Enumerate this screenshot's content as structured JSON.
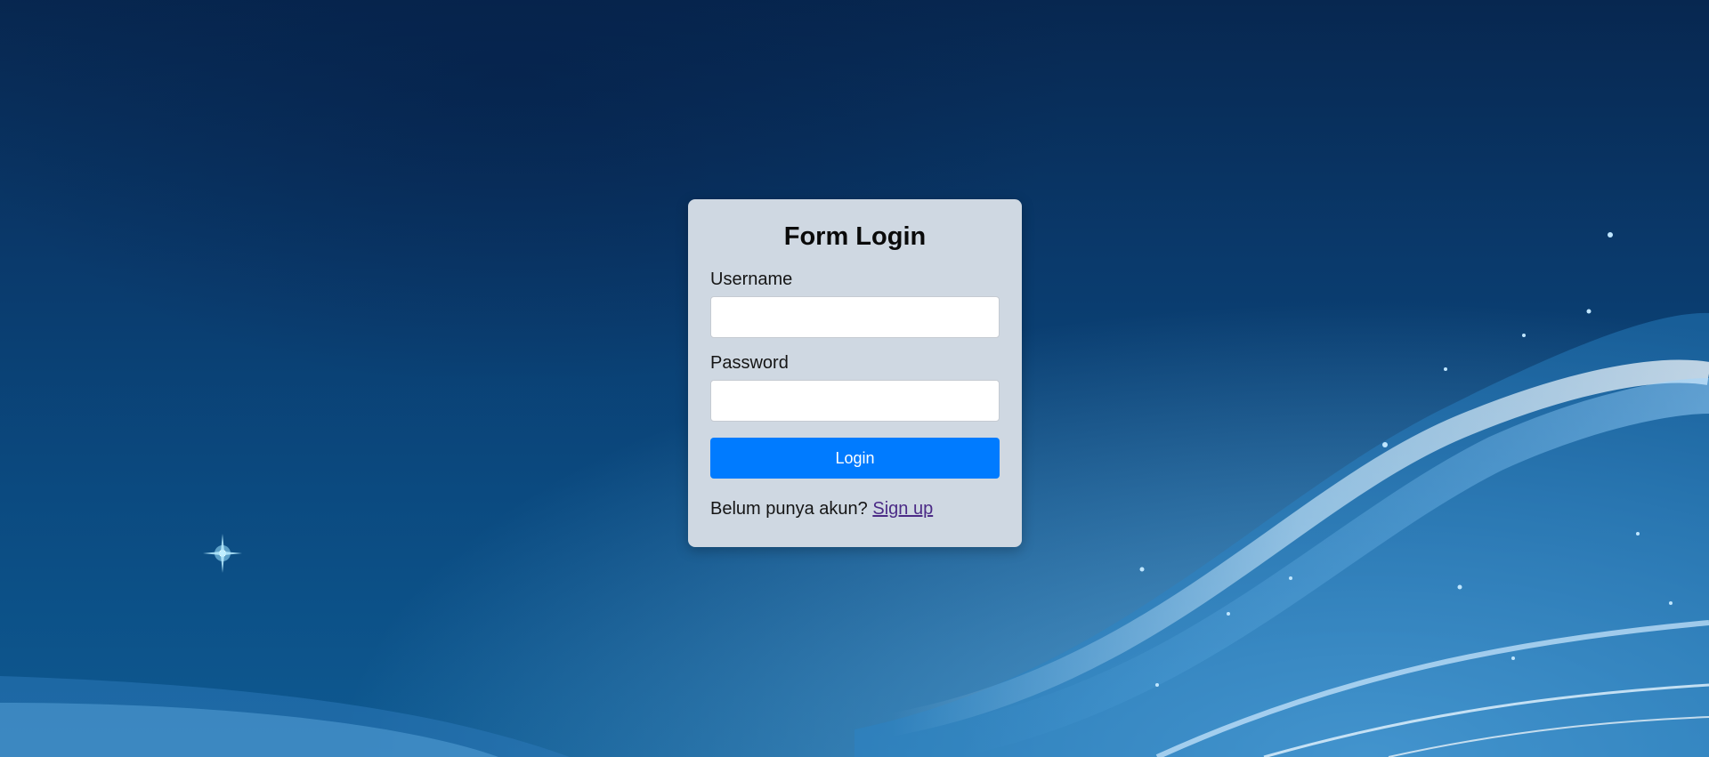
{
  "form": {
    "title": "Form Login",
    "username_label": "Username",
    "username_value": "",
    "password_label": "Password",
    "password_value": "",
    "login_button": "Login",
    "signup_prompt": "Belum punya akun?",
    "signup_link": "Sign up"
  },
  "colors": {
    "card_background": "#cfd8e2",
    "button_primary": "#007bff",
    "link_visited": "#4b2a86",
    "background_deep": "#072750",
    "background_light": "#0e5a92"
  }
}
